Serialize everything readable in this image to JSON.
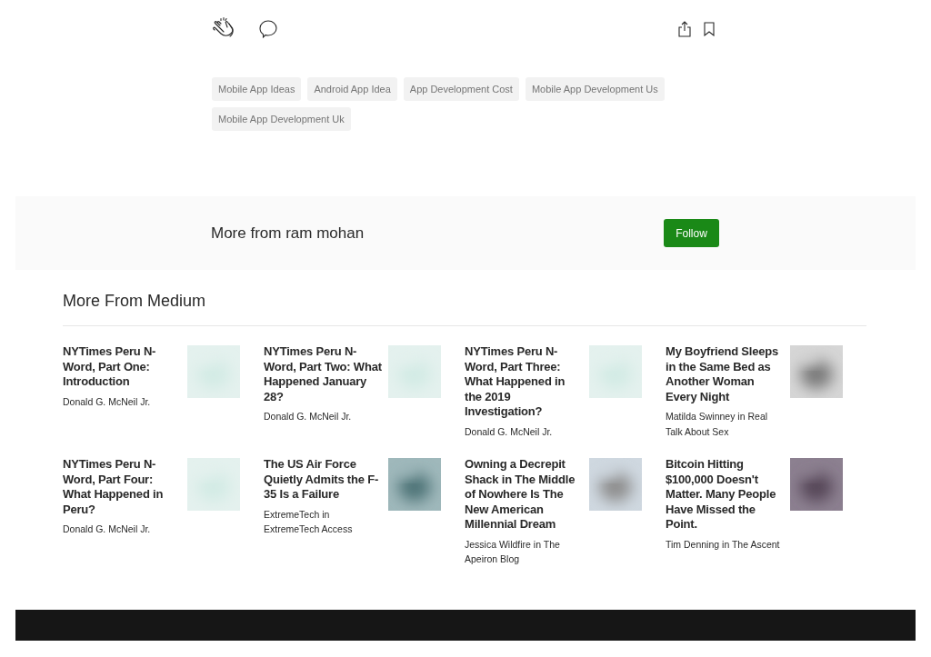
{
  "tags": [
    "Mobile App Ideas",
    "Android App Idea",
    "App Development Cost",
    "Mobile App Development Us",
    "Mobile App Development Uk"
  ],
  "more_from_author": {
    "title": "More from ram mohan",
    "button": "Follow"
  },
  "more_from_medium": {
    "title": "More From Medium",
    "articles": [
      {
        "title": "NYTimes Peru N-Word, Part One: Introduction",
        "byline": "Donald G. McNeil Jr."
      },
      {
        "title": "NYTimes Peru N-Word, Part Two: What Happened January 28?",
        "byline": "Donald G. McNeil Jr."
      },
      {
        "title": "NYTimes Peru N-Word, Part Three: What Happened in the 2019 Investigation?",
        "byline": "Donald G. McNeil Jr."
      },
      {
        "title": "My Boyfriend Sleeps in the Same Bed as Another Woman Every Night",
        "byline": "Matilda Swinney in Real Talk About Sex"
      },
      {
        "title": "NYTimes Peru N-Word, Part Four: What Happened in Peru?",
        "byline": "Donald G. McNeil Jr."
      },
      {
        "title": "The US Air Force Quietly Admits the F-35 Is a Failure",
        "byline": "ExtremeTech in ExtremeTech Access"
      },
      {
        "title": "Owning a Decrepit Shack in The Middle of Nowhere Is The New American Millennial Dream",
        "byline": "Jessica Wildfire in The Apeiron Blog"
      },
      {
        "title": "Bitcoin Hitting $100,000 Doesn't Matter. Many People Have Missed the Point.",
        "byline": "Tim Denning in The Ascent"
      }
    ]
  }
}
